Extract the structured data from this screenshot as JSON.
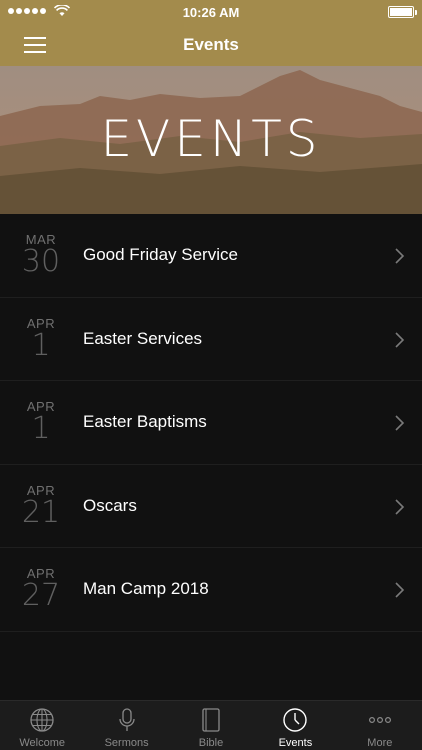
{
  "status_bar": {
    "time": "10:26 AM"
  },
  "nav": {
    "title": "Events"
  },
  "hero": {
    "title": "EVENTS"
  },
  "events": [
    {
      "month": "MAR",
      "day": "30",
      "title": "Good Friday Service"
    },
    {
      "month": "APR",
      "day": "1",
      "title": "Easter Services"
    },
    {
      "month": "APR",
      "day": "1",
      "title": "Easter Baptisms"
    },
    {
      "month": "APR",
      "day": "21",
      "title": "Oscars"
    },
    {
      "month": "APR",
      "day": "27",
      "title": "Man Camp 2018"
    }
  ],
  "tabs": [
    {
      "label": "Welcome",
      "icon": "globe-icon",
      "active": false
    },
    {
      "label": "Sermons",
      "icon": "microphone-icon",
      "active": false
    },
    {
      "label": "Bible",
      "icon": "book-icon",
      "active": false
    },
    {
      "label": "Events",
      "icon": "clock-icon",
      "active": true
    },
    {
      "label": "More",
      "icon": "more-dots-icon",
      "active": false
    }
  ],
  "colors": {
    "header": "#a38b4c",
    "background": "#111111",
    "tab_bar": "#1c1c1c"
  }
}
